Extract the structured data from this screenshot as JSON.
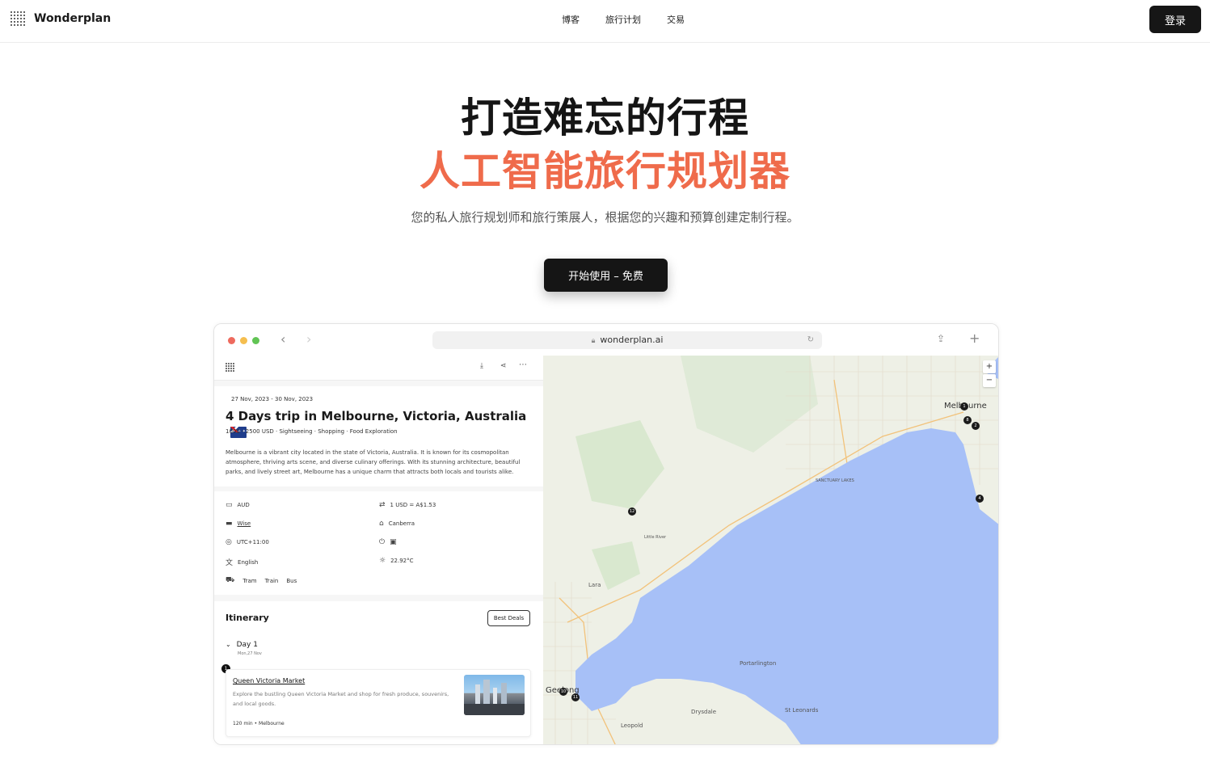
{
  "nav": {
    "brand": "Wonderplan",
    "links": [
      "博客",
      "旅行计划",
      "交易"
    ],
    "login": "登录"
  },
  "hero": {
    "line1": "打造难忘的行程",
    "line2": "人工智能旅行规划器",
    "subtitle": "您的私人旅行规划师和旅行策展人，根据您的兴趣和预算创建定制行程。",
    "cta": "开始使用 – 免费"
  },
  "browser": {
    "url": "wonderplan.ai"
  },
  "trip": {
    "dates": "27 Nov, 2023 - 30 Nov, 2023",
    "title": "4 Days trip in Melbourne, Victoria, Australia",
    "tags": "1000 - 2500 USD · Sightseeing · Shopping · Food Exploration",
    "desc": "Melbourne is a vibrant city located in the state of Victoria, Australia. It is known for its cosmopolitan atmosphere, thriving arts scene, and diverse culinary offerings. With its stunning architecture, beautiful parks, and lively street art, Melbourne has a unique charm that attracts both locals and tourists alike."
  },
  "info": {
    "currency": "AUD",
    "rate": "1 USD = A$1.53",
    "payment": "Wise",
    "capital": "Canberra",
    "timezone": "UTC+11:00",
    "language": "English",
    "weather": "22.92°C",
    "transport": [
      "Tram",
      "Train",
      "Bus"
    ]
  },
  "itinerary": {
    "heading": "Itinerary",
    "deals": "Best Deals",
    "day": "Day 1",
    "day_date": "Mon,27 Nov",
    "stop_number": "1",
    "stop_name": "Queen Victoria Market",
    "stop_desc": "Explore the bustling Queen Victoria Market and shop for fresh produce, souvenirs, and local goods.",
    "stop_meta": "120 min • Melbourne"
  },
  "map": {
    "zoom_in": "+",
    "zoom_out": "−",
    "places": [
      "Melbourne",
      "Lara",
      "Little River",
      "Geelong",
      "Portarlington",
      "Drysdale",
      "St Leonards",
      "Leopold",
      "SANCTUARY LAKES"
    ],
    "pins": [
      "1",
      "2",
      "4",
      "8",
      "10",
      "11",
      "12"
    ]
  },
  "colors": {
    "accent": "#ef6b4b",
    "dark": "#151515",
    "water": "#a7c0f7",
    "land": "#eef0e6"
  }
}
